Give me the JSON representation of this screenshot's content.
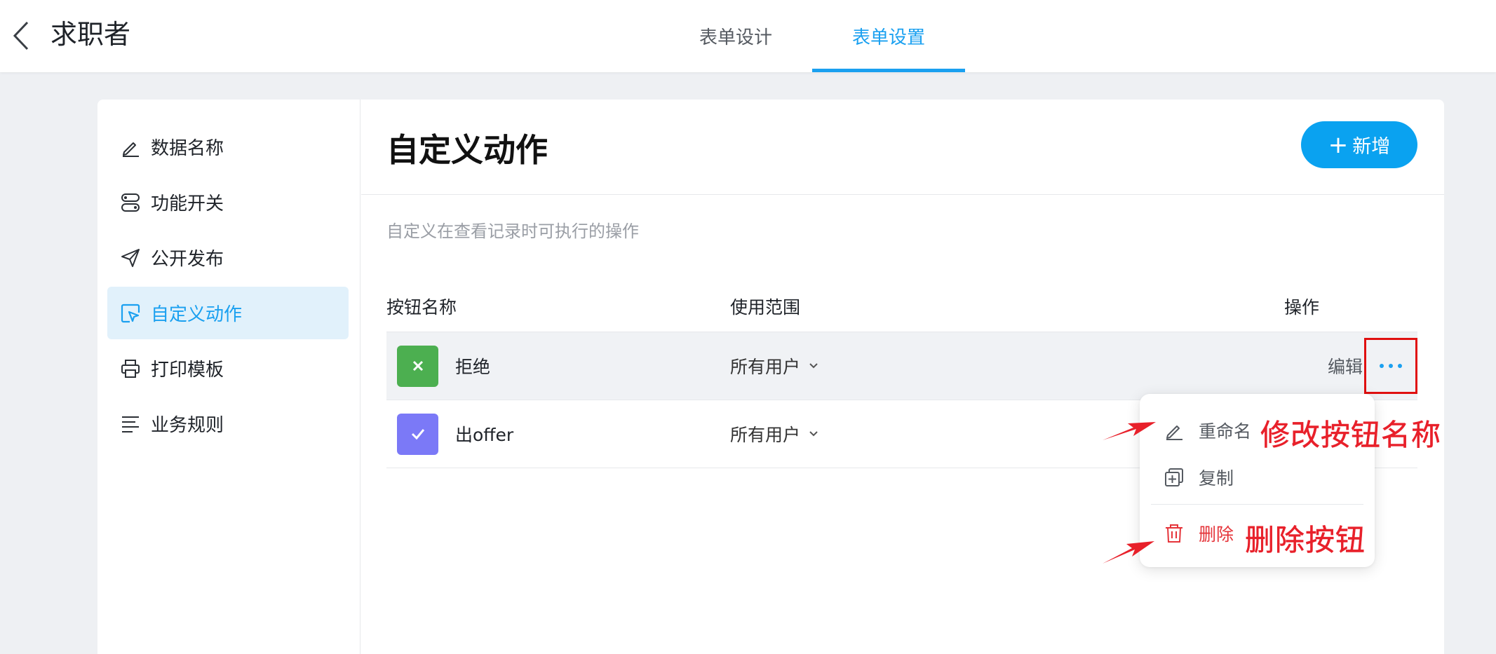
{
  "header": {
    "title": "求职者",
    "tabs": [
      {
        "label": "表单设计",
        "active": false
      },
      {
        "label": "表单设置",
        "active": true
      }
    ]
  },
  "sidebar": {
    "items": [
      {
        "label": "数据名称",
        "icon": "pen-icon"
      },
      {
        "label": "功能开关",
        "icon": "toggle-icon"
      },
      {
        "label": "公开发布",
        "icon": "send-icon"
      },
      {
        "label": "自定义动作",
        "icon": "cursor-click-icon",
        "active": true
      },
      {
        "label": "打印模板",
        "icon": "printer-icon"
      },
      {
        "label": "业务规则",
        "icon": "lines-icon"
      }
    ]
  },
  "main": {
    "title": "自定义动作",
    "add_button": "新增",
    "description": "自定义在查看记录时可执行的操作",
    "table": {
      "columns": [
        "按钮名称",
        "使用范围",
        "操作"
      ],
      "rows": [
        {
          "name": "拒绝",
          "scope": "所有用户",
          "badge_color": "#4caf50",
          "icon": "x-icon",
          "edit": "编辑"
        },
        {
          "name": "出offer",
          "scope": "所有用户",
          "badge_color": "#7b79f7",
          "icon": "check-icon"
        }
      ]
    }
  },
  "menu": {
    "items": [
      {
        "label": "重命名",
        "icon": "pen-icon"
      },
      {
        "label": "复制",
        "icon": "copy-icon"
      },
      {
        "label": "删除",
        "icon": "trash-icon",
        "danger": true
      }
    ]
  },
  "annotations": {
    "rename_note": "修改按钮名称",
    "delete_note": "删除按钮"
  },
  "colors": {
    "accent": "#1aa0f0",
    "danger": "#e5343a",
    "annotation": "#e8202a"
  }
}
